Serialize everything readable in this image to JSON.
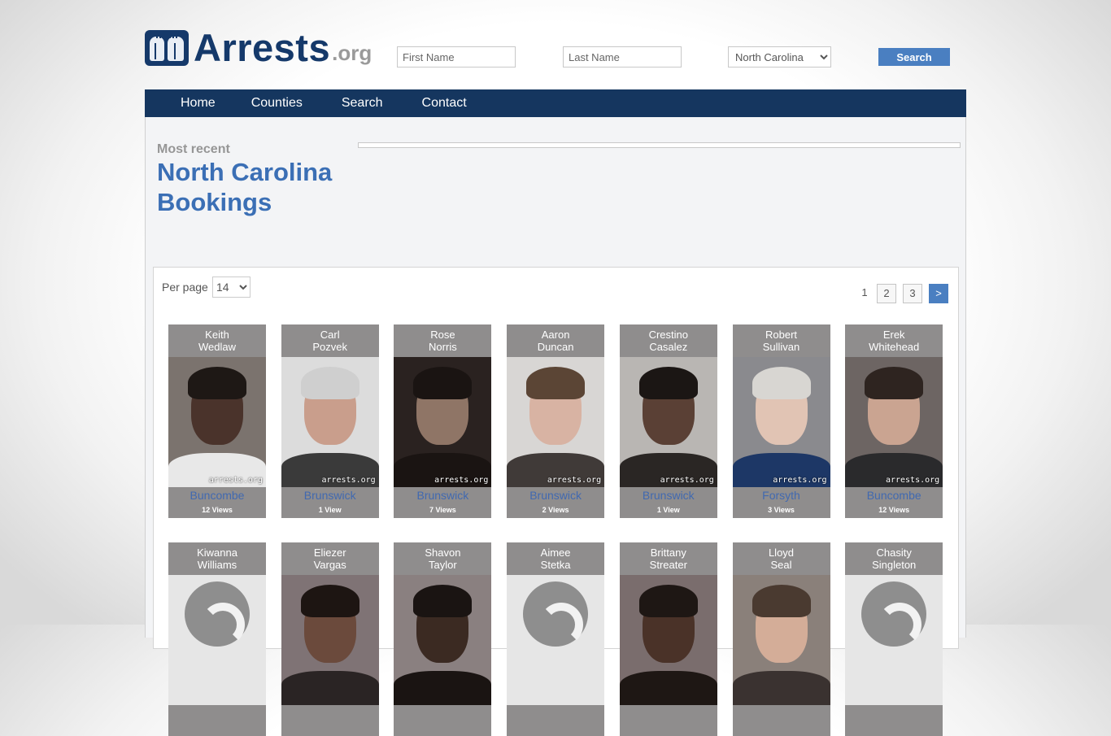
{
  "brand": {
    "name": "Arrests",
    "tld": ".org"
  },
  "search": {
    "first_name_placeholder": "First Name",
    "last_name_placeholder": "Last Name",
    "state_selected": "North Carolina",
    "button_label": "Search"
  },
  "nav": {
    "items": [
      "Home",
      "Counties",
      "Search",
      "Contact"
    ]
  },
  "heading": {
    "kicker": "Most recent",
    "title": "North Carolina Bookings"
  },
  "listing": {
    "per_page_label": "Per page",
    "per_page_value": "14",
    "pagination": {
      "current": "1",
      "pages": [
        "2",
        "3"
      ],
      "next": ">"
    }
  },
  "watermark": "arrests.org",
  "colors": {
    "brand_navy": "#15365f",
    "accent_blue": "#4a7fc1",
    "title_blue": "#3b6fb5",
    "card_gray": "#8f8d8d"
  },
  "bookings": [
    {
      "first": "Keith",
      "last": "Wedlaw",
      "county": "Buncombe",
      "views": "12 Views",
      "photo": true
    },
    {
      "first": "Carl",
      "last": "Pozvek",
      "county": "Brunswick",
      "views": "1 View",
      "photo": true
    },
    {
      "first": "Rose",
      "last": "Norris",
      "county": "Brunswick",
      "views": "7 Views",
      "photo": true
    },
    {
      "first": "Aaron",
      "last": "Duncan",
      "county": "Brunswick",
      "views": "2 Views",
      "photo": true
    },
    {
      "first": "Crestino",
      "last": "Casalez",
      "county": "Brunswick",
      "views": "1 View",
      "photo": true
    },
    {
      "first": "Robert",
      "last": "Sullivan",
      "county": "Forsyth",
      "views": "3 Views",
      "photo": true
    },
    {
      "first": "Erek",
      "last": "Whitehead",
      "county": "Buncombe",
      "views": "12 Views",
      "photo": true
    },
    {
      "first": "Kiwanna",
      "last": "Williams",
      "photo": false
    },
    {
      "first": "Eliezer",
      "last": "Vargas",
      "photo": true
    },
    {
      "first": "Shavon",
      "last": "Taylor",
      "photo": true
    },
    {
      "first": "Aimee",
      "last": "Stetka",
      "photo": false
    },
    {
      "first": "Brittany",
      "last": "Streater",
      "photo": true
    },
    {
      "first": "Lloyd",
      "last": "Seal",
      "photo": true
    },
    {
      "first": "Chasity",
      "last": "Singleton",
      "photo": false
    }
  ]
}
